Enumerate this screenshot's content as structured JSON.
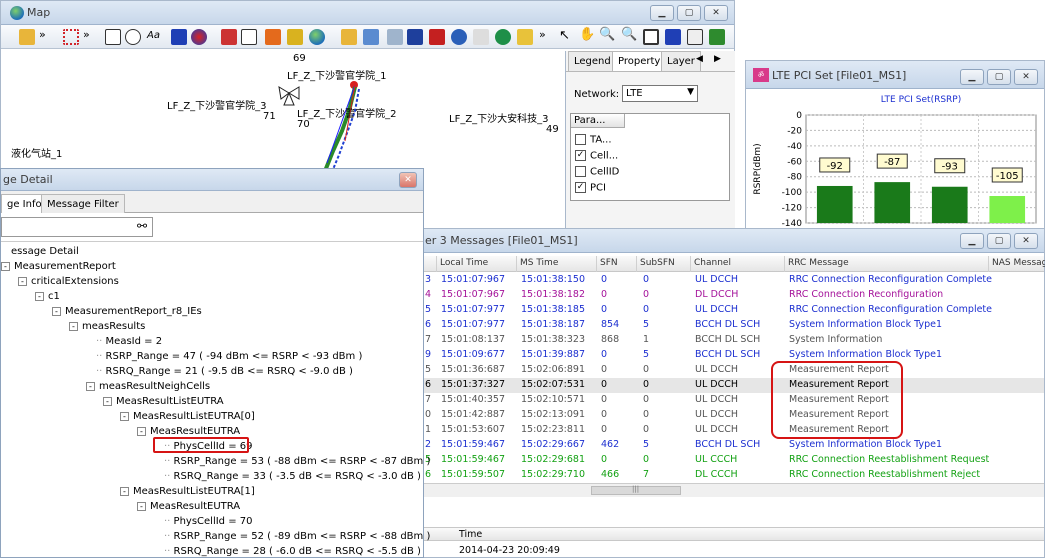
{
  "map_window": {
    "title": "Map",
    "legend_tabs": [
      "Legend",
      "Property",
      "Layer"
    ],
    "network_label": "Network:",
    "network_value": "LTE",
    "params_header": "Para...",
    "params": [
      {
        "label": "TA...",
        "checked": false
      },
      {
        "label": "Cell...",
        "checked": true
      },
      {
        "label": "CellID",
        "checked": false
      },
      {
        "label": "PCI",
        "checked": true
      }
    ],
    "map_labels": {
      "cell1": "LF_Z_下沙警官学院_1",
      "cell2": "LF_Z_下沙警官学院_2",
      "cell3": "LF_Z_下沙警官学院_3",
      "cell4": "LF_Z_下沙大安科技_3",
      "station": "液化气站_1",
      "pci69": "69",
      "pci70": "70",
      "pci71": "71",
      "pci49": "49"
    }
  },
  "pci_window": {
    "title": "LTE PCI Set [File01_MS1]",
    "chart_data": {
      "type": "bar",
      "title": "LTE PCI Set(RSRP)",
      "ylabel": "RSRP(dBm)",
      "ylim": [
        -140,
        0
      ],
      "yticks": [
        "0",
        "-20",
        "-40",
        "-60",
        "-80",
        "-100",
        "-120",
        "-140"
      ],
      "values": [
        -92,
        -87,
        -93,
        -105
      ],
      "data_labels": [
        "-92",
        "-87",
        "-93",
        "-105"
      ],
      "colors": [
        "#1a7a1a",
        "#1a7a1a",
        "#1a7a1a",
        "#7ef04a"
      ]
    }
  },
  "l3_window": {
    "title": "Layer 3 Messages [File01_MS1]",
    "title_visible": "er 3 Messages [File01_MS1]",
    "columns": [
      "Local Time",
      "MS Time",
      "SFN",
      "SubSFN",
      "Channel",
      "RRC Message",
      "NAS Message"
    ],
    "rows": [
      {
        "idx": "3",
        "local": "15:01:07:967",
        "ms": "15:01:38:150",
        "sfn": "0",
        "sub": "0",
        "ch": "UL DCCH",
        "rrc": "RRC Connection Reconfiguration Complete",
        "color": "#1c2fd0"
      },
      {
        "idx": "4",
        "local": "15:01:07:967",
        "ms": "15:01:38:182",
        "sfn": "0",
        "sub": "0",
        "ch": "DL DCCH",
        "rrc": "RRC Connection Reconfiguration",
        "color": "#a4129a"
      },
      {
        "idx": "5",
        "local": "15:01:07:977",
        "ms": "15:01:38:185",
        "sfn": "0",
        "sub": "0",
        "ch": "UL DCCH",
        "rrc": "RRC Connection Reconfiguration Complete",
        "color": "#1c2fd0"
      },
      {
        "idx": "6",
        "local": "15:01:07:977",
        "ms": "15:01:38:187",
        "sfn": "854",
        "sub": "5",
        "ch": "BCCH DL SCH",
        "rrc": "System Information Block Type1",
        "color": "#1c2fd0"
      },
      {
        "idx": "7",
        "local": "15:01:08:137",
        "ms": "15:01:38:323",
        "sfn": "868",
        "sub": "1",
        "ch": "BCCH DL SCH",
        "rrc": "System Information",
        "color": "#555555"
      },
      {
        "idx": "9",
        "local": "15:01:09:677",
        "ms": "15:01:39:887",
        "sfn": "0",
        "sub": "5",
        "ch": "BCCH DL SCH",
        "rrc": "System Information Block Type1",
        "color": "#1c2fd0"
      },
      {
        "idx": "5",
        "local": "15:01:36:687",
        "ms": "15:02:06:891",
        "sfn": "0",
        "sub": "0",
        "ch": "UL DCCH",
        "rrc": "Measurement Report",
        "color": "#555555"
      },
      {
        "idx": "6",
        "local": "15:01:37:327",
        "ms": "15:02:07:531",
        "sfn": "0",
        "sub": "0",
        "ch": "UL DCCH",
        "rrc": "Measurement Report",
        "color": "#000000"
      },
      {
        "idx": "7",
        "local": "15:01:40:357",
        "ms": "15:02:10:571",
        "sfn": "0",
        "sub": "0",
        "ch": "UL DCCH",
        "rrc": "Measurement Report",
        "color": "#555555"
      },
      {
        "idx": "0",
        "local": "15:01:42:887",
        "ms": "15:02:13:091",
        "sfn": "0",
        "sub": "0",
        "ch": "UL DCCH",
        "rrc": "Measurement Report",
        "color": "#555555"
      },
      {
        "idx": "1",
        "local": "15:01:53:607",
        "ms": "15:02:23:811",
        "sfn": "0",
        "sub": "0",
        "ch": "UL DCCH",
        "rrc": "Measurement Report",
        "color": "#555555"
      },
      {
        "idx": "2",
        "local": "15:01:59:467",
        "ms": "15:02:29:667",
        "sfn": "462",
        "sub": "5",
        "ch": "BCCH DL SCH",
        "rrc": "System Information Block Type1",
        "color": "#1c2fd0"
      },
      {
        "idx": "5",
        "local": "15:01:59:467",
        "ms": "15:02:29:681",
        "sfn": "0",
        "sub": "0",
        "ch": "UL CCCH",
        "rrc": "RRC Connection Reestablishment Request",
        "color": "#13a113"
      },
      {
        "idx": "6",
        "local": "15:01:59:507",
        "ms": "15:02:29:710",
        "sfn": "466",
        "sub": "7",
        "ch": "DL CCCH",
        "rrc": "RRC Connection Reestablishment Reject",
        "color": "#13a113"
      }
    ],
    "bottom_header": "Time",
    "bottom_value": "2014-04-23 20:09:49"
  },
  "detail_window": {
    "title_visible": "ge Detail",
    "tabs": [
      "ge Info",
      "Message Filter"
    ],
    "tree": [
      {
        "text": "essage Detail",
        "level": 0,
        "exp": ""
      },
      {
        "text": "MeasurementReport",
        "level": 0,
        "exp": "-"
      },
      {
        "text": "criticalExtensions",
        "level": 1,
        "exp": "-"
      },
      {
        "text": "c1",
        "level": 2,
        "exp": "-"
      },
      {
        "text": "MeasurementReport_r8_IEs",
        "level": 3,
        "exp": "-"
      },
      {
        "text": "measResults",
        "level": 4,
        "exp": "-"
      },
      {
        "text": "MeasId = 2",
        "level": 5,
        "exp": ""
      },
      {
        "text": "RSRP_Range = 47 ( -94 dBm <= RSRP < -93 dBm )",
        "level": 5,
        "exp": ""
      },
      {
        "text": "RSRQ_Range = 21 ( -9.5 dB <= RSRQ < -9.0 dB )",
        "level": 5,
        "exp": ""
      },
      {
        "text": "measResultNeighCells",
        "level": 5,
        "exp": "-"
      },
      {
        "text": "MeasResultListEUTRA",
        "level": 6,
        "exp": "-"
      },
      {
        "text": "MeasResultListEUTRA[0]",
        "level": 7,
        "exp": "-"
      },
      {
        "text": "MeasResultEUTRA",
        "level": 8,
        "exp": "-"
      },
      {
        "text": "PhysCellId = 69",
        "level": 9,
        "exp": ""
      },
      {
        "text": "RSRP_Range = 53 ( -88 dBm <= RSRP < -87 dBm )",
        "level": 9,
        "exp": ""
      },
      {
        "text": "RSRQ_Range = 33 ( -3.5 dB <= RSRQ < -3.0 dB )",
        "level": 9,
        "exp": ""
      },
      {
        "text": "MeasResultListEUTRA[1]",
        "level": 7,
        "exp": "-"
      },
      {
        "text": "MeasResultEUTRA",
        "level": 8,
        "exp": "-"
      },
      {
        "text": "PhysCellId = 70",
        "level": 9,
        "exp": ""
      },
      {
        "text": "RSRP_Range = 52 ( -89 dBm <= RSRP < -88 dBm )",
        "level": 9,
        "exp": ""
      },
      {
        "text": "RSRQ_Range = 28 ( -6.0 dB <= RSRQ < -5.5 dB )",
        "level": 9,
        "exp": ""
      }
    ]
  }
}
